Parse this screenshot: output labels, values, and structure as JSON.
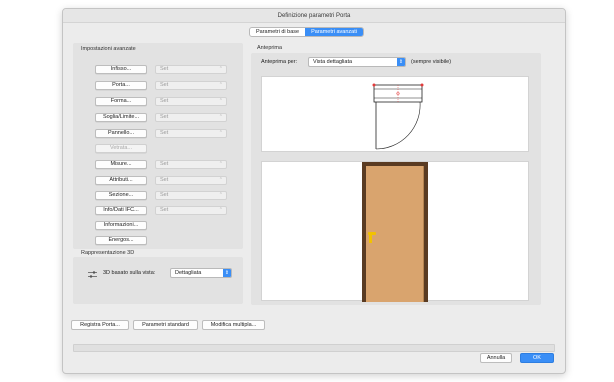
{
  "window": {
    "title": "Definizione parametri Porta"
  },
  "tabs": [
    {
      "label": "Parametri di base",
      "active": false
    },
    {
      "label": "Parametri avanzati",
      "active": true
    }
  ],
  "advanced": {
    "title": "Impostazioni avanzate",
    "rows": [
      {
        "button": "Infisso...",
        "enabled": true,
        "select": "Set"
      },
      {
        "button": "Porta...",
        "enabled": true,
        "select": "Set"
      },
      {
        "button": "Forma...",
        "enabled": true,
        "select": "Set"
      },
      {
        "button": "Soglia/Limite...",
        "enabled": true,
        "select": "Set"
      },
      {
        "button": "Pannello...",
        "enabled": true,
        "select": "Set"
      },
      {
        "button": "Vetrata...",
        "enabled": false,
        "select": null
      },
      {
        "button": "Misure...",
        "enabled": true,
        "select": "Set"
      },
      {
        "button": "Attributi...",
        "enabled": true,
        "select": "Set"
      },
      {
        "button": "Sezione...",
        "enabled": true,
        "select": "Set"
      },
      {
        "button": "Info/Dati IFC...",
        "enabled": true,
        "select": "Set"
      },
      {
        "button": "Informazioni...",
        "enabled": true,
        "select": null
      },
      {
        "button": "Energos...",
        "enabled": true,
        "select": null
      }
    ]
  },
  "rep3d": {
    "title": "Rappresentazione 3D",
    "label": "3D basato sulla vista:",
    "value": "Dettagliata",
    "icon": "sliders-icon"
  },
  "preview": {
    "title": "Anteprima",
    "label": "Anteprima per:",
    "value": "Vista dettagliata",
    "note": "(sempre visibile)",
    "colors": {
      "door": "#d9a46e",
      "frame": "#5a3b22",
      "handle": "#f2c200",
      "marker": "#e23b3b"
    }
  },
  "footer": {
    "register": "Registra Porta...",
    "standard": "Parametri standard",
    "modify": "Modifica multipla...",
    "cancel": "Annulla",
    "ok": "OK"
  }
}
